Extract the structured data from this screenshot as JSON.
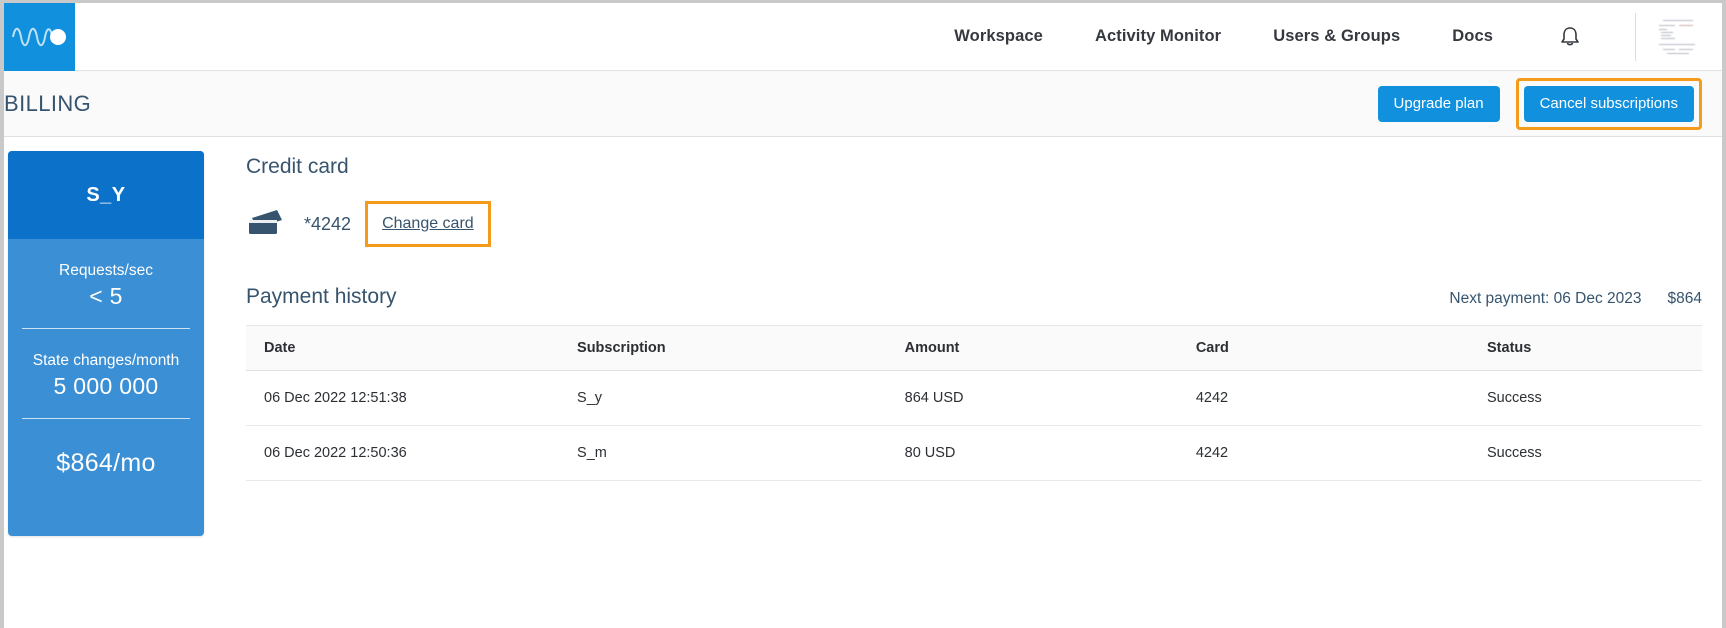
{
  "nav": {
    "logo_name": "waveform-logo",
    "items": [
      {
        "label": "Workspace"
      },
      {
        "label": "Activity Monitor"
      },
      {
        "label": "Users & Groups"
      },
      {
        "label": "Docs"
      }
    ],
    "bell_icon": "bell-icon",
    "avatar_icon": "avatar-thumbnail"
  },
  "header": {
    "title": "BILLING",
    "upgrade_label": "Upgrade plan",
    "cancel_label": "Cancel subscriptions",
    "accent_blue": "#1190dd",
    "highlight_orange": "#f59b1c"
  },
  "plan": {
    "name": "S_Y",
    "metrics": [
      {
        "label": "Requests/sec",
        "value": "< 5"
      },
      {
        "label": "State changes/month",
        "value": "5 000 000"
      }
    ],
    "price": "$864/mo",
    "head_color": "#0b71c9",
    "body_color": "#3b8fd4"
  },
  "credit_card": {
    "title": "Credit card",
    "icon": "credit-card-icon",
    "last4": "*4242",
    "change_label": "Change card"
  },
  "payment_history": {
    "title": "Payment history",
    "next_payment_label": "Next payment: 06 Dec 2023",
    "next_payment_amount": "$864",
    "columns": [
      "Date",
      "Subscription",
      "Amount",
      "Card",
      "Status"
    ],
    "rows": [
      {
        "date": "06 Dec 2022 12:51:38",
        "subscription": "S_y",
        "amount": "864 USD",
        "card": "4242",
        "status": "Success"
      },
      {
        "date": "06 Dec 2022 12:50:36",
        "subscription": "S_m",
        "amount": "80 USD",
        "card": "4242",
        "status": "Success"
      }
    ],
    "status_color": "#1f9d3d"
  }
}
